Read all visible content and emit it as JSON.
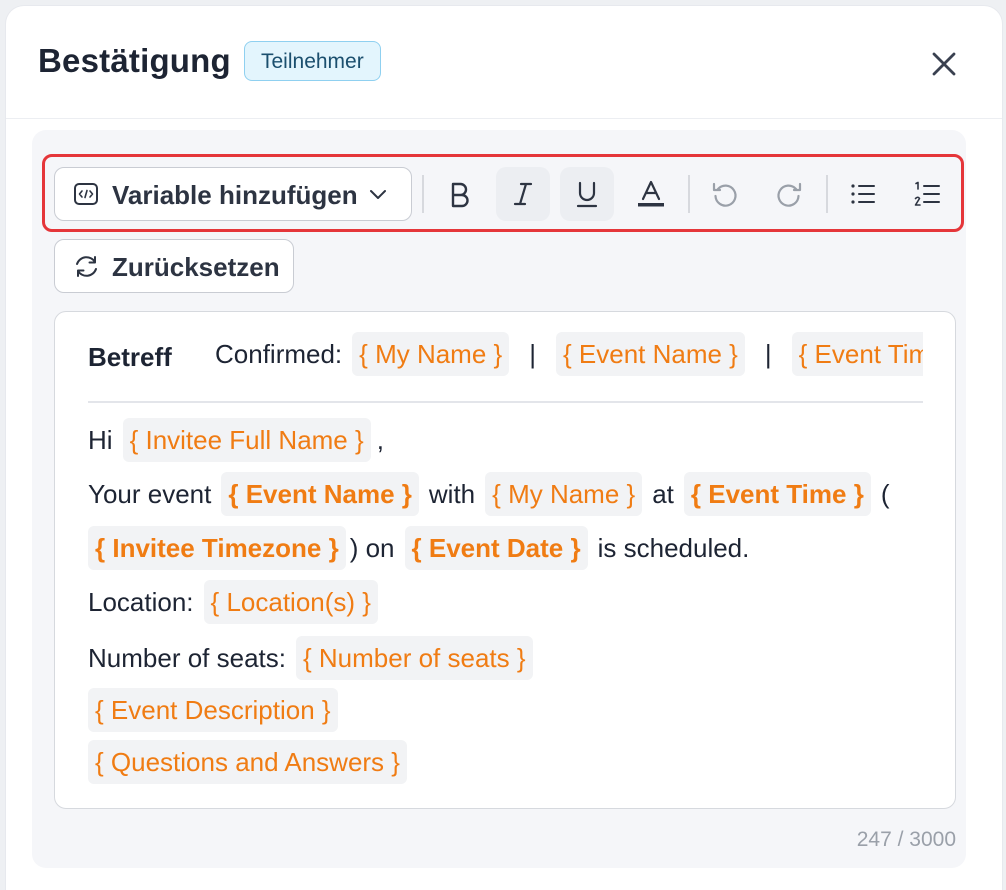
{
  "dialog": {
    "title": "Bestätigung",
    "badge": "Teilnehmer",
    "close_icon": "close-icon"
  },
  "toolbar": {
    "variable_button": "Variable hinzufügen",
    "icons": [
      "code-icon",
      "chevron-down-icon",
      "bold-icon",
      "italic-icon",
      "underline-icon",
      "text-color-icon",
      "undo-icon",
      "redo-icon",
      "bullet-list-icon",
      "numbered-list-icon"
    ],
    "reset_button": "Zurücksetzen"
  },
  "editor": {
    "subject_label": "Betreff",
    "subject": {
      "prefix": "Confirmed:",
      "var1": "{ My Name }",
      "pipe1": "|",
      "var2": "{ Event Name }",
      "pipe2": "|",
      "var3": "{ Event Time }"
    },
    "body": {
      "l1_hi": "Hi",
      "l1_var": "{ Invitee Full Name }",
      "l1_comma": ",",
      "l2_your_event": "Your event",
      "l2_var_event_name": "{ Event Name }",
      "l2_with": "with",
      "l2_var_my_name": "{ My Name }",
      "l2_at": "at",
      "l2_var_event_time": "{ Event Time }",
      "l2_paren": "(",
      "l3_var_tz": "{ Invitee Timezone }",
      "l3_on": ") on",
      "l3_var_date": "{ Event Date }",
      "l3_scheduled": "is scheduled.",
      "l4_location": "Location:",
      "l4_var": "{ Location(s) }",
      "l5_seats": "Number of seats:",
      "l5_var": "{ Number of seats }",
      "l6_var": "{ Event Description }",
      "l7_var": "{ Questions and Answers }"
    }
  },
  "counter": "247 / 3000",
  "colors": {
    "variable": "#f07c13",
    "highlight_border": "#e5363a",
    "badge_bg": "#e3f5fd"
  }
}
